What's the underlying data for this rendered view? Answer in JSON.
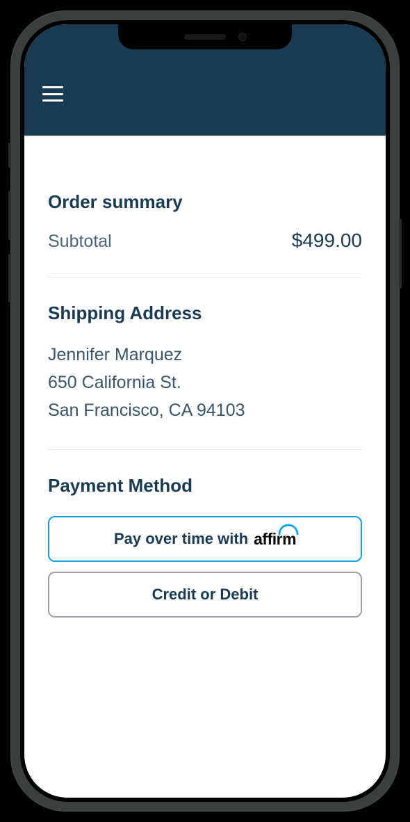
{
  "order_summary": {
    "title": "Order summary",
    "subtotal_label": "Subtotal",
    "subtotal_value": "$499.00"
  },
  "shipping": {
    "title": "Shipping Address",
    "name": "Jennifer Marquez",
    "street": "650 California St.",
    "city_state_zip": "San Francisco, CA 94103"
  },
  "payment": {
    "title": "Payment Method",
    "affirm_prefix": "Pay over time with",
    "affirm_brand": "affirm",
    "card_label": "Credit or Debit"
  }
}
